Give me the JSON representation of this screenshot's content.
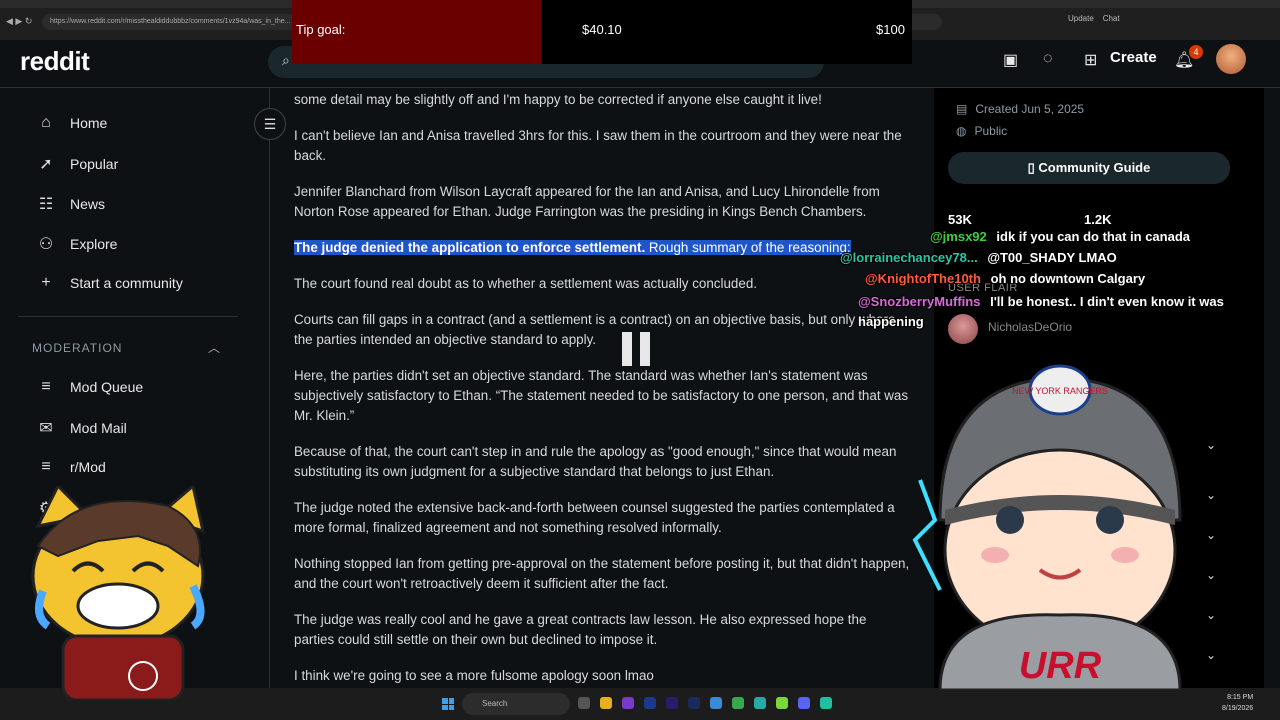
{
  "browser": {
    "url": "https://www.reddit.com/r/missthealdiddubbbz/comments/1vz94a/was_in_the...",
    "right_label": "Update",
    "chat_label": "Chat"
  },
  "tip_goal": {
    "label": "Tip goal:",
    "current": "$40.10",
    "target": "$100",
    "progress": 0.401
  },
  "header": {
    "logo": "reddit",
    "create_label": "Create",
    "notification_count": "4"
  },
  "sidebar": {
    "items": [
      {
        "label": "Home",
        "icon": "home-icon"
      },
      {
        "label": "Popular",
        "icon": "popular-icon"
      },
      {
        "label": "News",
        "icon": "news-icon"
      },
      {
        "label": "Explore",
        "icon": "explore-icon"
      },
      {
        "label": "Start a community",
        "icon": "plus-icon"
      }
    ],
    "moderation_label": "MODERATION",
    "mod_items": [
      {
        "label": "Mod Queue",
        "icon": "mod-queue-icon"
      },
      {
        "label": "Mod Mail",
        "icon": "mod-mail-icon"
      },
      {
        "label": "r/Mod",
        "icon": "mod-icon"
      }
    ]
  },
  "post": {
    "p0": "some detail may be slightly off and I'm happy to be corrected if anyone else caught it live!",
    "p1": "I can't believe Ian and Anisa travelled 3hrs for this. I saw them in the courtroom and they were near the back.",
    "p2": "Jennifer Blanchard from Wilson Laycraft appeared for the Ian and Anisa, and Lucy Lhirondelle from Norton Rose appeared for Ethan. Judge Farrington was the presiding in Kings Bench Chambers.",
    "p3_bold": "The judge denied the application to enforce settlement.",
    "p3_rest": " Rough summary of the reasoning:",
    "p4": "The court found real doubt as to whether a settlement was actually concluded.",
    "p5": "Courts can fill gaps in a contract (and a settlement is a contract) on an objective basis, but only where the parties intended an objective standard to apply.",
    "p6": "Here, the parties didn't set an objective standard. The standard was whether Ian's statement was subjectively satisfactory to Ethan. “The statement needed to be satisfactory to one person, and that was Mr. Klein.”",
    "p7": "Because of that, the court can't step in and rule the apology as \"good enough,\" since that would mean substituting its own judgment for a subjective standard that belongs to just Ethan.",
    "p8": "The judge noted the extensive back-and-forth between counsel suggested the parties contemplated a more formal, finalized agreement and not something resolved informally.",
    "p9": "Nothing stopped Ian from getting pre-approval on the statement before posting it, but that didn't happen, and the court won't retroactively deem it sufficient after the fact.",
    "p10": "The judge was really cool and he gave a great contracts law lesson. He also expressed hope the parties could still settle on their own but declined to impose it.",
    "p11": "I think we're going to see a more fulsome apology soon lmao"
  },
  "right_panel": {
    "created": "Created Jun 5, 2025",
    "visibility": "Public",
    "guide_label": "Community Guide",
    "members": "53K",
    "online": "1.2K",
    "flair_label": "USER FLAIR",
    "flair_user": "NicholasDeOrio"
  },
  "chat": [
    {
      "user": "@jmsx92",
      "msg": "idk if you can do that in canada",
      "color": "#3ad13a"
    },
    {
      "user": "@lorrainechancey78...",
      "msg": "@T00_SHADY LMAO",
      "color": "#2ec4a6"
    },
    {
      "user": "@KnightofThe10th",
      "msg": "oh no downtown Calgary",
      "color": "#ff5a3c"
    },
    {
      "user": "@SnozberryMuffins",
      "msg": "I'll be honest.. I din't even know it was happening",
      "color": "#d96ad9"
    }
  ],
  "taskbar": {
    "search_label": "Search",
    "time": "8:15 PM",
    "date": "8/19/2026"
  },
  "overlay": {
    "jersey_text": "URR",
    "cap_text": "NEW YORK RANGERS"
  },
  "colors": {
    "highlight": "#1d56c9",
    "notif": "#d93900",
    "tip_fill": "#6b0000"
  }
}
